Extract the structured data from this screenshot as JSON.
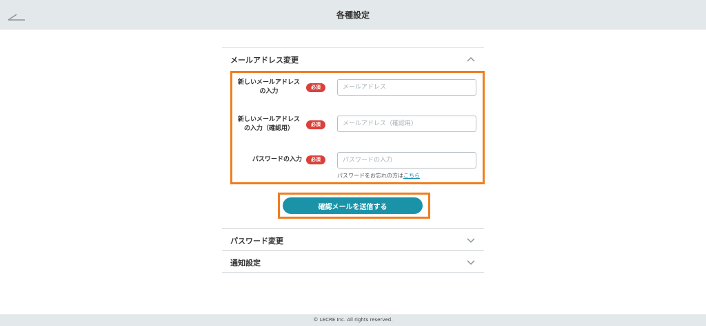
{
  "header": {
    "title": "各種設定",
    "back_icon": "back-arrow-icon"
  },
  "email_section": {
    "title": "メールアドレス変更",
    "expanded": true,
    "fields": [
      {
        "label": "新しいメールアドレスの入力",
        "required": "必須",
        "placeholder": "メールアドレス",
        "value": ""
      },
      {
        "label": "新しいメールアドレスの入力（確認用）",
        "required": "必須",
        "placeholder": "メールアドレス（確認用）",
        "value": ""
      },
      {
        "label": "パスワードの入力",
        "required": "必須",
        "placeholder": "パスワードの入力",
        "value": ""
      }
    ],
    "forgot_text": "パスワードをお忘れの方は",
    "forgot_link": "こちら",
    "submit_label": "確認メールを送信する"
  },
  "password_section": {
    "title": "パスワード変更",
    "expanded": false
  },
  "notify_section": {
    "title": "通知設定",
    "expanded": false
  },
  "footer": {
    "copyright": "© LECRE Inc. All rights reserved."
  },
  "colors": {
    "header_bg": "#e3e8ea",
    "accent": "#1a93a9",
    "required_badge": "#d9413a",
    "highlight": "#f07d1e"
  }
}
